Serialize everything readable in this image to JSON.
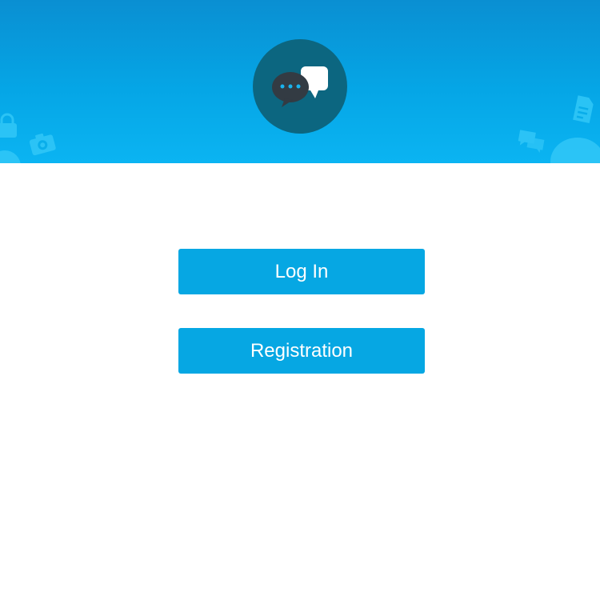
{
  "header": {
    "logo_icon": "chat-bubbles-icon",
    "decorations": [
      "lock-icon",
      "camera-icon",
      "document-icon",
      "chat-icon",
      "speech-bubble-icon"
    ]
  },
  "actions": {
    "login_label": "Log In",
    "registration_label": "Registration"
  },
  "colors": {
    "header_top": "#0a8fd2",
    "header_bottom": "#0bb4f2",
    "logo_circle": "#0c6680",
    "button": "#06a7e3",
    "button_text": "#ffffff",
    "background": "#ffffff"
  }
}
